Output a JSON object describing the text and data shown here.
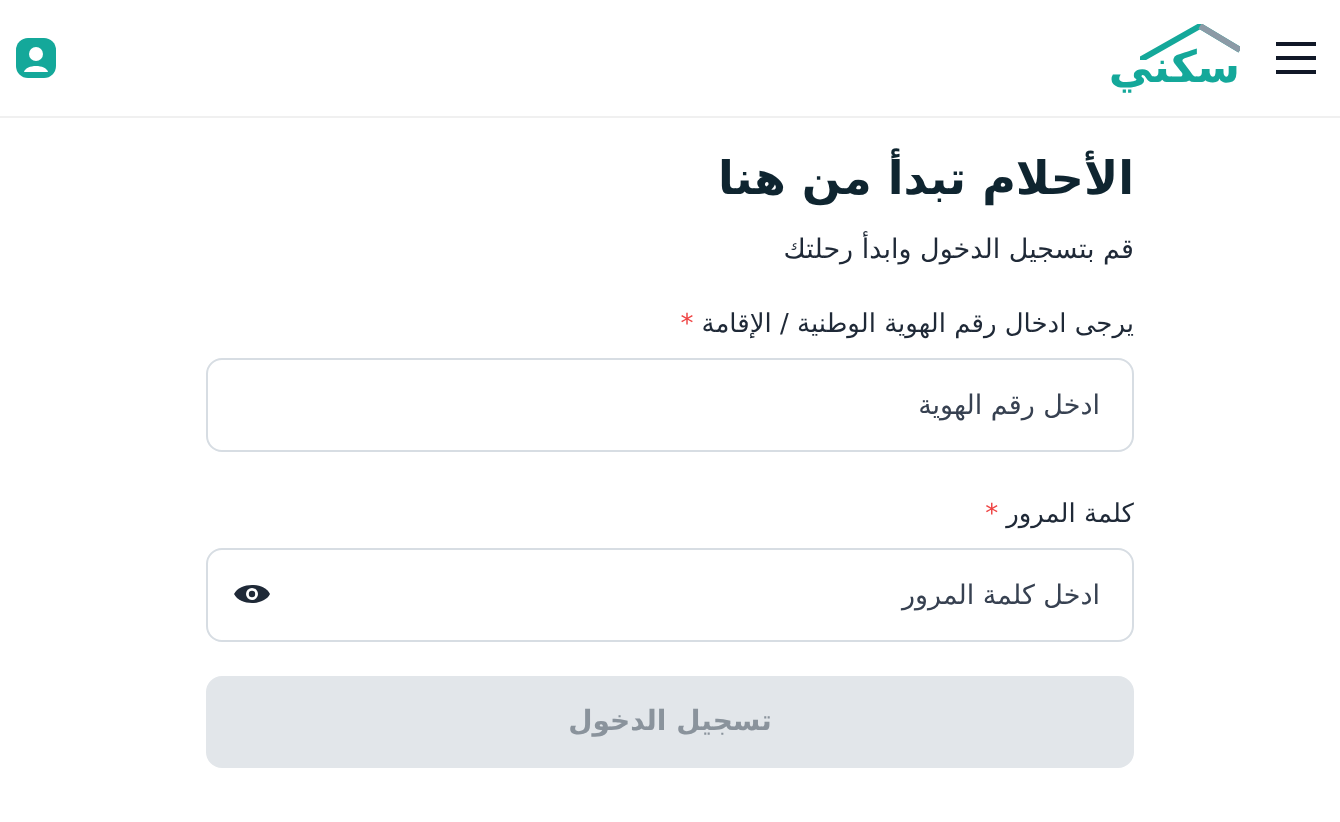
{
  "header": {
    "logo_text": "سكني"
  },
  "form": {
    "title": "الأحلام تبدأ من هنا",
    "subtitle": "قم بتسجيل الدخول وابدأ رحلتك",
    "fields": [
      {
        "kind": "text",
        "label": "يرجى ادخال رقم الهوية الوطنية / الإقامة",
        "required_mark": "*",
        "placeholder": "ادخل رقم الهوية"
      },
      {
        "kind": "password",
        "label": "كلمة المرور",
        "required_mark": "*",
        "placeholder": "ادخل كلمة المرور"
      }
    ],
    "submit": {
      "label": "تسجيل الدخول",
      "disabled": true
    }
  }
}
